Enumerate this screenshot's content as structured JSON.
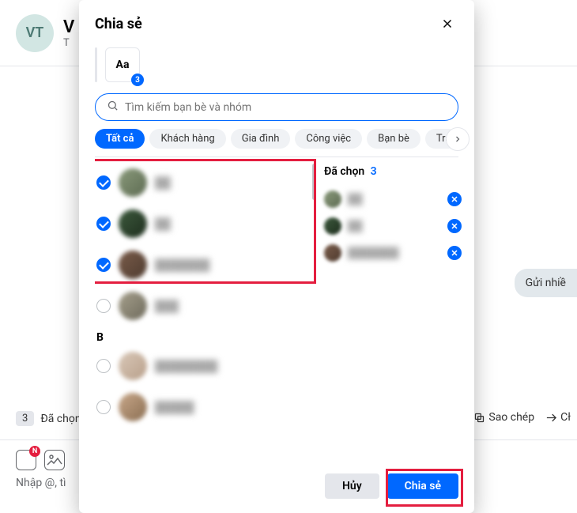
{
  "background": {
    "avatar_initials": "VT",
    "title_letter": "V",
    "sub_letter": "T",
    "right_bubble": "Gửi nhiề",
    "selected_label": "Đã chọn",
    "selected_count": "3",
    "tool_copy": "Sao chép",
    "tool_share": "Cł",
    "input_hint": "Nhập @, tì"
  },
  "modal": {
    "title": "Chia sẻ",
    "preview_text": "Aa",
    "preview_badge": "3",
    "search_placeholder": "Tìm kiếm bạn bè và nhóm",
    "tabs": [
      "Tất cả",
      "Khách hàng",
      "Gia đình",
      "Công việc",
      "Bạn bè",
      "Trả lời s"
    ],
    "selected_header": "Đã chọn",
    "selected_count": "3",
    "contacts": [
      {
        "name": "██",
        "checked": true,
        "avatar": "av-a"
      },
      {
        "name": "██",
        "checked": true,
        "avatar": "av-b"
      },
      {
        "name": "███████",
        "checked": true,
        "avatar": "av-c"
      },
      {
        "name": "███",
        "checked": false,
        "avatar": "av-d"
      }
    ],
    "letter_header": "B",
    "contacts_b": [
      {
        "name": "████████",
        "checked": false,
        "avatar": "av-e"
      },
      {
        "name": "█████",
        "checked": false,
        "avatar": "av-f"
      }
    ],
    "selected_items": [
      {
        "name": "██",
        "avatar": "av-a"
      },
      {
        "name": "██",
        "avatar": "av-b"
      },
      {
        "name": "███████",
        "avatar": "av-c"
      }
    ],
    "cancel_label": "Hủy",
    "share_label": "Chia sẻ"
  }
}
